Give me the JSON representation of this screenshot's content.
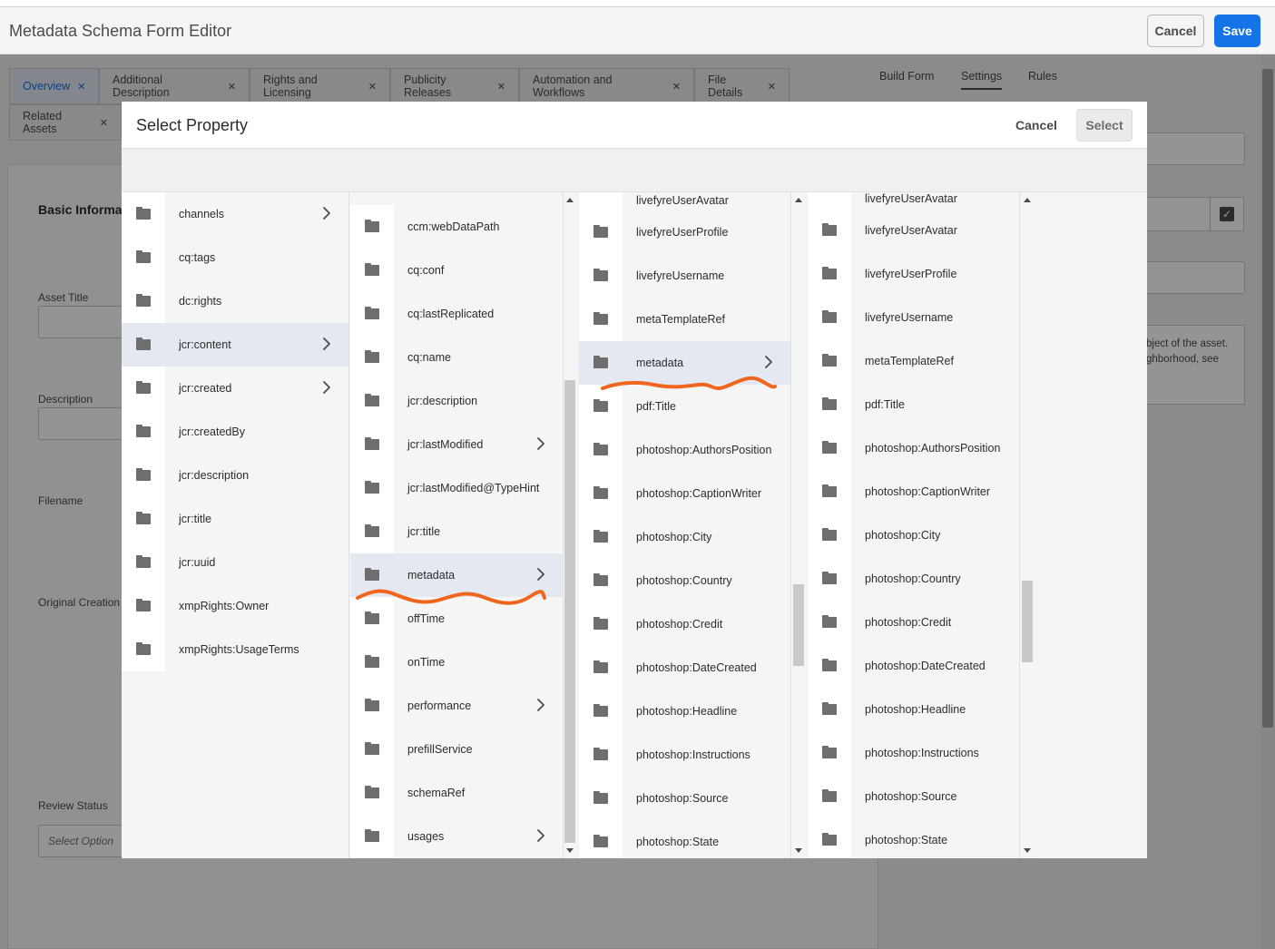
{
  "app": {
    "title": "Metadata Schema Form Editor",
    "cancel_label": "Cancel",
    "save_label": "Save"
  },
  "form_tabs": [
    {
      "label": "Overview",
      "active": true
    },
    {
      "label": "Additional Description"
    },
    {
      "label": "Rights and Licensing"
    },
    {
      "label": "Publicity Releases"
    },
    {
      "label": "Automation and Workflows"
    },
    {
      "label": "File Details"
    },
    {
      "label": "Related Assets"
    }
  ],
  "right_tabs": {
    "build_form": "Build Form",
    "settings": "Settings",
    "rules": "Rules"
  },
  "form": {
    "section_title": "Basic Informat",
    "asset_title_label": "Asset Title",
    "description_label": "Description",
    "filename_label": "Filename",
    "original_creation_label": "Original Creation",
    "review_status_label": "Review Status",
    "review_status_placeholder": "Select Option"
  },
  "right_panel": {
    "help_text_line1": "bject of the asset.",
    "help_text_line2": "ghborhood, see"
  },
  "dialog": {
    "title": "Select Property",
    "cancel_label": "Cancel",
    "select_label": "Select",
    "columns": [
      {
        "items": [
          {
            "label": "channels",
            "has_children": true
          },
          {
            "label": "cq:tags"
          },
          {
            "label": "dc:rights"
          },
          {
            "label": "jcr:content",
            "has_children": true,
            "selected": true
          },
          {
            "label": "jcr:created",
            "has_children": true
          },
          {
            "label": "jcr:createdBy"
          },
          {
            "label": "jcr:description"
          },
          {
            "label": "jcr:title"
          },
          {
            "label": "jcr:uuid"
          },
          {
            "label": "xmpRights:Owner"
          },
          {
            "label": "xmpRights:UsageTerms"
          }
        ]
      },
      {
        "items": [
          {
            "label": "ccm:webDataPath"
          },
          {
            "label": "cq:conf"
          },
          {
            "label": "cq:lastReplicated"
          },
          {
            "label": "cq:name"
          },
          {
            "label": "jcr:description"
          },
          {
            "label": "jcr:lastModified",
            "has_children": true
          },
          {
            "label": "jcr:lastModified@TypeHint"
          },
          {
            "label": "jcr:title"
          },
          {
            "label": "metadata",
            "has_children": true,
            "selected": true
          },
          {
            "label": "offTime"
          },
          {
            "label": "onTime"
          },
          {
            "label": "performance",
            "has_children": true
          },
          {
            "label": "prefillService"
          },
          {
            "label": "schemaRef"
          },
          {
            "label": "usages",
            "has_children": true
          }
        ]
      },
      {
        "partial_top": "livefyreUserAvatar",
        "items": [
          {
            "label": "livefyreUserProfile"
          },
          {
            "label": "livefyreUsername"
          },
          {
            "label": "metaTemplateRef"
          },
          {
            "label": "metadata",
            "has_children": true,
            "selected": true
          },
          {
            "label": "pdf:Title"
          },
          {
            "label": "photoshop:AuthorsPosition"
          },
          {
            "label": "photoshop:CaptionWriter"
          },
          {
            "label": "photoshop:City"
          },
          {
            "label": "photoshop:Country"
          },
          {
            "label": "photoshop:Credit"
          },
          {
            "label": "photoshop:DateCreated"
          },
          {
            "label": "photoshop:Headline"
          },
          {
            "label": "photoshop:Instructions"
          },
          {
            "label": "photoshop:Source"
          },
          {
            "label": "photoshop:State"
          }
        ]
      },
      {
        "partial_top": "livefyreUserAvatar",
        "items": [
          {
            "label": "livefyreUserAvatar"
          },
          {
            "label": "livefyreUserProfile"
          },
          {
            "label": "livefyreUsername"
          },
          {
            "label": "metaTemplateRef"
          },
          {
            "label": "pdf:Title"
          },
          {
            "label": "photoshop:AuthorsPosition"
          },
          {
            "label": "photoshop:CaptionWriter"
          },
          {
            "label": "photoshop:City"
          },
          {
            "label": "photoshop:Country"
          },
          {
            "label": "photoshop:Credit"
          },
          {
            "label": "photoshop:DateCreated"
          },
          {
            "label": "photoshop:Headline"
          },
          {
            "label": "photoshop:Instructions"
          },
          {
            "label": "photoshop:Source"
          },
          {
            "label": "photoshop:State"
          }
        ]
      }
    ]
  },
  "icons": {
    "folder": "folder-icon",
    "chevron": "chevron-right-icon",
    "close": "close-icon",
    "checkbox": "checkbox-checked-icon"
  },
  "colors": {
    "accent": "#1473e6",
    "annotation": "#f0661f",
    "selected_row": "#e3e8f1"
  }
}
